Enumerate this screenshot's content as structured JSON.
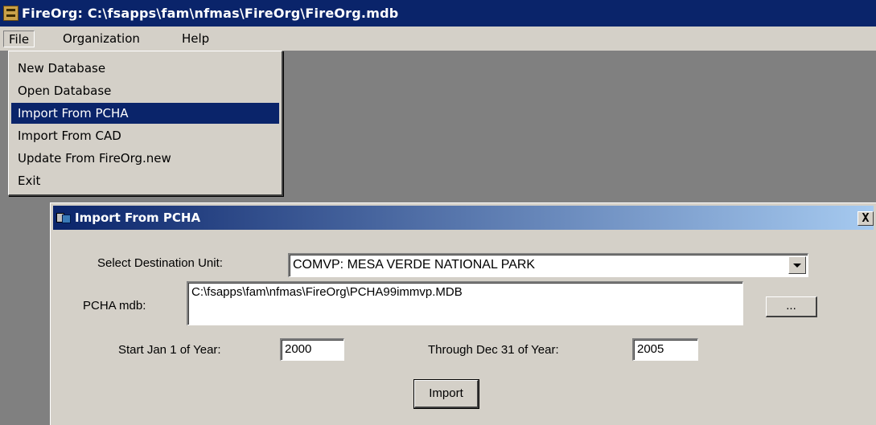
{
  "window": {
    "title": "FireOrg: C:\\fsapps\\fam\\nfmas\\FireOrg\\FireOrg.mdb"
  },
  "menubar": {
    "file": "File",
    "organization": "Organization",
    "help": "Help"
  },
  "file_menu": {
    "items": [
      {
        "label": "New Database"
      },
      {
        "label": "Open Database"
      },
      {
        "label": "Import From PCHA",
        "selected": true
      },
      {
        "label": "Import From CAD"
      },
      {
        "label": "Update From FireOrg.new"
      },
      {
        "label": "Exit"
      }
    ]
  },
  "dialog": {
    "title": "Import From PCHA",
    "close_symbol": "X",
    "destination_label": "Select Destination Unit:",
    "destination_value": "COMVP: MESA VERDE NATIONAL PARK",
    "pcha_label": "PCHA mdb:",
    "pcha_value": "C:\\fsapps\\fam\\nfmas\\FireOrg\\PCHA99immvp.MDB",
    "browse_label": "...",
    "start_label": "Start Jan 1 of Year:",
    "start_value": "2000",
    "end_label": "Through Dec 31 of Year:",
    "end_value": "2005",
    "import_label": "Import"
  },
  "colors": {
    "titlebar": "#0a246a",
    "menu_face": "#d4d0c8",
    "selection": "#0a246a",
    "workspace": "#808080"
  }
}
